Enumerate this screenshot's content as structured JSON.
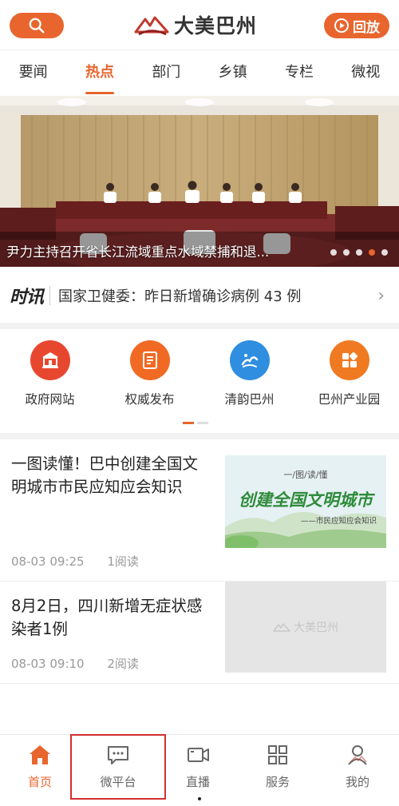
{
  "header": {
    "logo_text": "大美巴州",
    "replay_label": "回放",
    "accent": "#e8652e"
  },
  "tabs": [
    {
      "label": "要闻",
      "active": false
    },
    {
      "label": "热点",
      "active": true
    },
    {
      "label": "部门",
      "active": false
    },
    {
      "label": "乡镇",
      "active": false
    },
    {
      "label": "专栏",
      "active": false
    },
    {
      "label": "微视",
      "active": false
    }
  ],
  "banner": {
    "caption": "尹力主持召开省长江流域重点水域禁捕和退...",
    "slide_count": 5,
    "active_slide": 4
  },
  "flash": {
    "brand": "时讯",
    "text": "国家卫健委：昨日新增确诊病例 43 例"
  },
  "quick_links": [
    {
      "label": "政府网站",
      "icon": "government-building-icon",
      "color": "#e8472f"
    },
    {
      "label": "权威发布",
      "icon": "document-icon",
      "color": "#f06a24"
    },
    {
      "label": "清韵巴州",
      "icon": "landscape-logo-icon",
      "color": "#2f8ee0"
    },
    {
      "label": "巴州产业园",
      "icon": "grid-blocks-icon",
      "color": "#f07a22"
    }
  ],
  "news": [
    {
      "title": "一图读懂！巴中创建全国文明城市市民应知应会知识",
      "time": "08-03 09:25",
      "reads": "1阅读",
      "thumb_kicker": "一/图/读/懂",
      "thumb_headline": "创建全国文明城市",
      "thumb_sub": "——市民应知应会知识"
    },
    {
      "title": "8月2日，四川新增无症状感染者1例",
      "time": "08-03 09:10",
      "reads": "2阅读",
      "thumb_placeholder": "大美巴州"
    }
  ],
  "bottom_nav": [
    {
      "label": "首页",
      "icon": "home-icon",
      "active": true
    },
    {
      "label": "微平台",
      "icon": "chat-bubble-icon",
      "active": false
    },
    {
      "label": "直播",
      "icon": "video-camera-icon",
      "active": false
    },
    {
      "label": "服务",
      "icon": "grid-icon",
      "active": false
    },
    {
      "label": "我的",
      "icon": "user-icon",
      "active": false
    }
  ]
}
